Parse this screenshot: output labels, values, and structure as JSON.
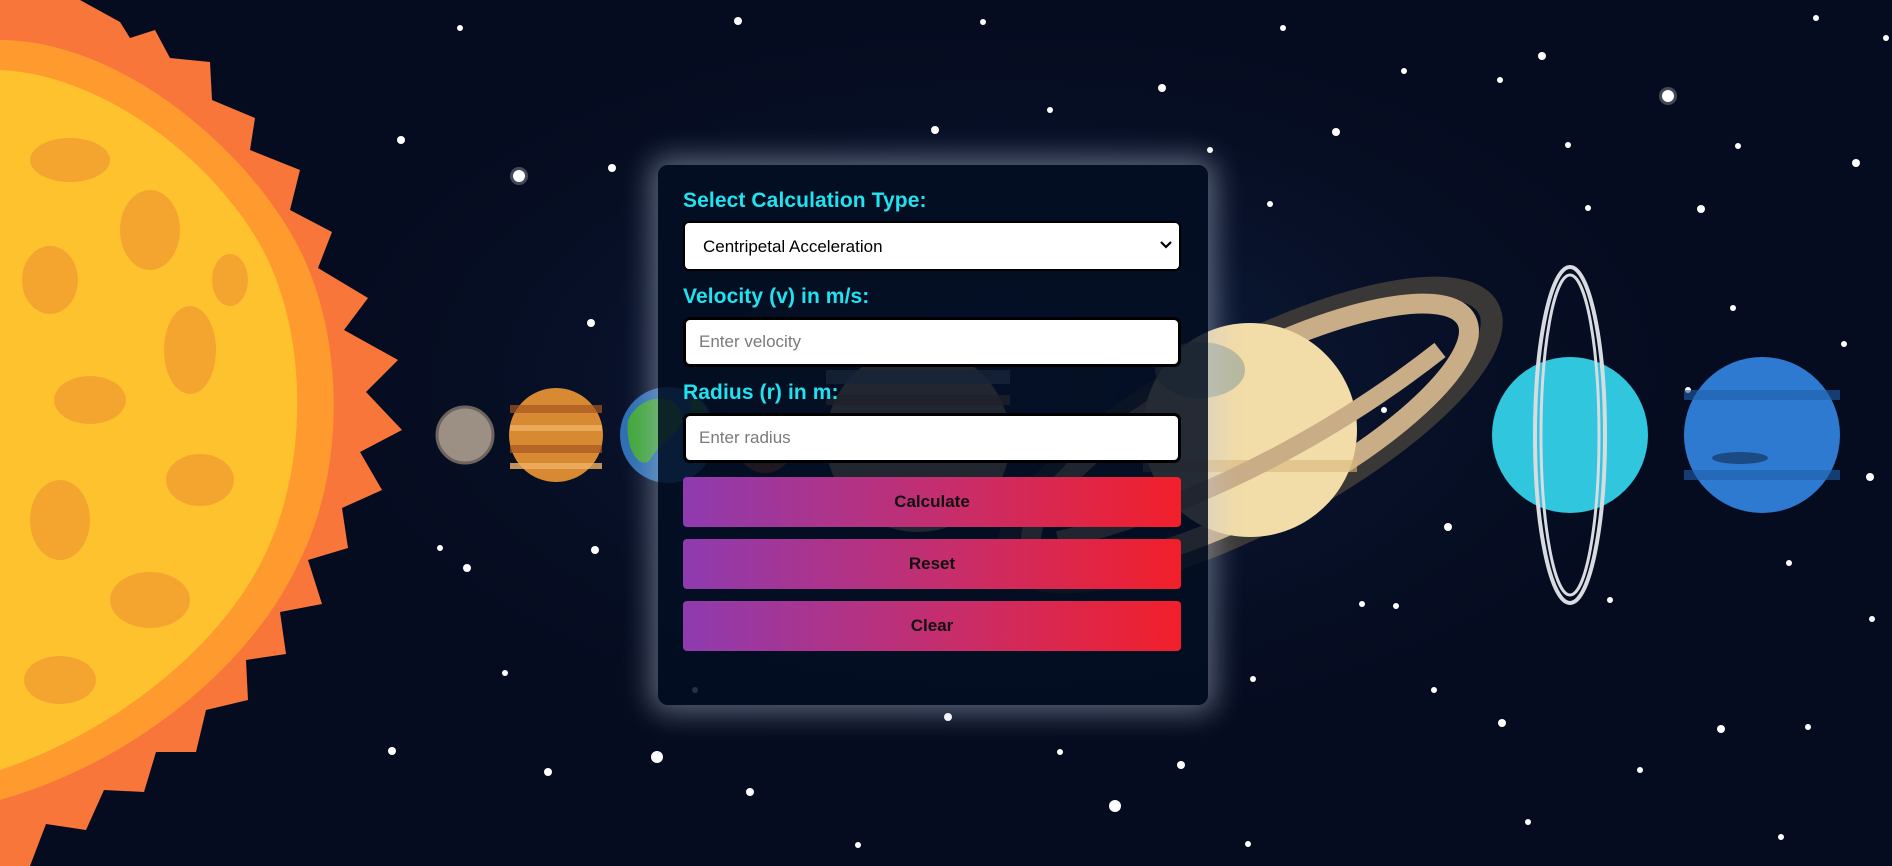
{
  "form": {
    "calc_type_label": "Select Calculation Type:",
    "calc_type_selected": "Centripetal Acceleration",
    "velocity_label": "Velocity (v) in m/s:",
    "velocity_placeholder": "Enter velocity",
    "velocity_value": "",
    "radius_label": "Radius (r) in m:",
    "radius_placeholder": "Enter radius",
    "radius_value": ""
  },
  "buttons": {
    "calculate": "Calculate",
    "reset": "Reset",
    "clear": "Clear"
  },
  "icons": {
    "select_arrow": "chevron-down-icon"
  },
  "colors": {
    "label": "#1fe3f0",
    "button_gradient_start": "#8e3bb0",
    "button_gradient_end": "#f21f2a",
    "panel_bg": "#040e22"
  }
}
